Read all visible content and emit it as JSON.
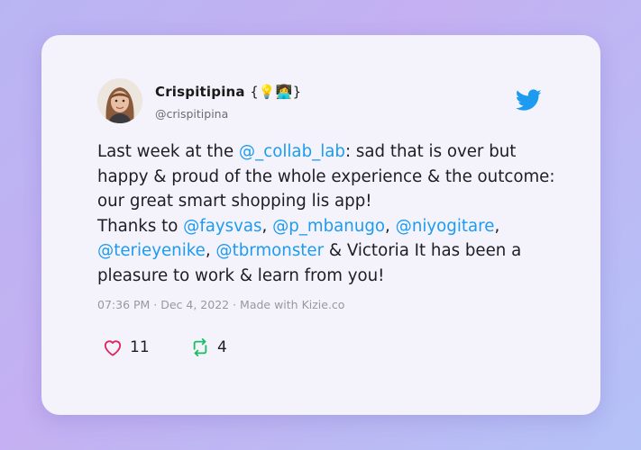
{
  "tweet": {
    "author_name": "Crispitipina",
    "author_emoji": "{💡👩‍💻}",
    "author_handle": "@crispitipina",
    "body": [
      {
        "text": "Last week at the "
      },
      {
        "text": "@_collab_lab",
        "mention": true
      },
      {
        "text": ": sad that is over but happy & proud of the whole experience & the outcome: our great smart shopping lis app!"
      },
      {
        "break": true
      },
      {
        "text": "Thanks to "
      },
      {
        "text": "@faysvas",
        "mention": true
      },
      {
        "text": ", "
      },
      {
        "text": "@p_mbanugo",
        "mention": true
      },
      {
        "text": ", "
      },
      {
        "text": "@niyogitare",
        "mention": true
      },
      {
        "text": ", "
      },
      {
        "text": "@terieyenike",
        "mention": true
      },
      {
        "text": ", "
      },
      {
        "text": "@tbrmonster",
        "mention": true
      },
      {
        "text": " & Victoria It has been a pleasure to work & learn from you!"
      }
    ],
    "meta": "07:36 PM · Dec 4, 2022 · Made with Kizie.co",
    "likes": "11",
    "retweets": "4"
  },
  "icons": {
    "twitter": "twitter-bird-icon",
    "like": "heart-icon",
    "retweet": "retweet-icon"
  },
  "colors": {
    "accent": "#1d9bf0",
    "like": "#e0245e",
    "retweet": "#17bf63"
  }
}
